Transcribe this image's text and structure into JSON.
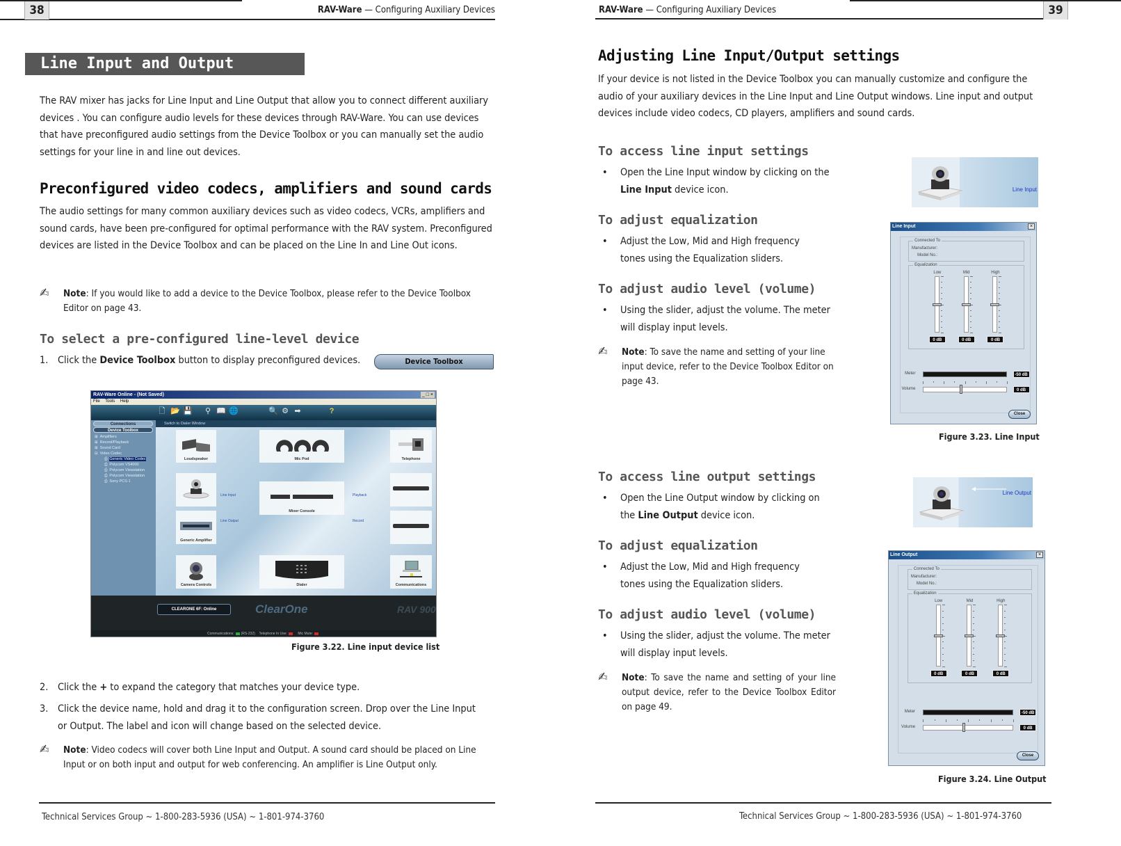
{
  "left_page": {
    "page_number": "38",
    "running_head": {
      "product": "RAV-Ware",
      "separator": "—",
      "section": "Configuring Auxiliary Devices"
    },
    "section_title": "Line Input and Output",
    "intro": "The RAV mixer has jacks for Line Input and Line Output that allow you to connect different auxiliary devices . You can configure audio levels for these devices through RAV-Ware. You can use devices that have preconfigured audio settings from the Device Toolbox or you can manually set the audio settings for your line in and line out devices.",
    "preconfigured": {
      "heading": "Preconfigured video codecs, amplifiers and sound cards",
      "body": "The audio settings for many common auxiliary devices such as video codecs, VCRs, amplifiers and sound cards, have been pre-configured for optimal performance with the RAV system. Preconfigured devices are listed in the Device Toolbox and can be placed on the Line In and Line Out icons."
    },
    "note1": {
      "label": "Note",
      "text": ": If you would like to add a device to the Device Toolbox, please refer to the Device Toolbox Editor on page 43."
    },
    "select_heading": "To select a pre-configured line-level device",
    "steps": [
      {
        "num": "1.",
        "pre": "Click the ",
        "bold": "Device Toolbox",
        "post": " button to display preconfigured devices."
      },
      {
        "num": "2.",
        "pre": "Click the ",
        "bold": "+",
        "post": " to expand the category that matches your device type."
      },
      {
        "num": "3.",
        "pre": "Click the device name, hold and drag it to the configuration screen. Drop over the Line Input or Output. The label and icon will change based on the selected device.",
        "bold": "",
        "post": ""
      }
    ],
    "device_toolbox_button": "Device Toolbox",
    "figure_caption": "Figure 3.22. Line input device list",
    "note2": {
      "label": "Note",
      "text": ": Video codecs will cover both Line Input and Output. A sound card should be placed on Line Input or on both input and output for web conferencing. An amplifier is Line Output only."
    },
    "footer": "Technical Services Group ~ 1-800-283-5936 (USA) ~ 1-801-974-3760"
  },
  "screenshot": {
    "title": "RAV-Ware    Online - (Not Saved)",
    "window_buttons": "_ □ ×",
    "menu": [
      "File",
      "Tools",
      "Help"
    ],
    "sidebar_buttons": {
      "connections": "Connections",
      "device_toolbox": "Device Toolbox"
    },
    "tree": [
      {
        "expander": "⊞",
        "label": "Amplifiers",
        "indent": false,
        "selected": false
      },
      {
        "expander": "⊞",
        "label": "Record/Playback",
        "indent": false,
        "selected": false
      },
      {
        "expander": "⊞",
        "label": "Sound Card",
        "indent": false,
        "selected": false
      },
      {
        "expander": "⊟",
        "label": "Video Codec",
        "indent": false,
        "selected": false
      },
      {
        "expander": "",
        "label": "Generic   Video Codec",
        "indent": true,
        "selected": true
      },
      {
        "expander": "",
        "label": "Polycom   VS4000",
        "indent": true,
        "selected": false
      },
      {
        "expander": "",
        "label": "Polycom   Viewstation",
        "indent": true,
        "selected": false
      },
      {
        "expander": "",
        "label": "Polycom   Viewstation",
        "indent": true,
        "selected": false
      },
      {
        "expander": "",
        "label": "Sony   PCS-1",
        "indent": true,
        "selected": false
      }
    ],
    "switch_link": "Switch to Dialer Window",
    "tiles": {
      "loudspeaker": "Loudspeaker",
      "mic_pod": "Mic Pod",
      "telephone": "Telephone",
      "camera_line_input": "",
      "mixer_console": "Mixer Console",
      "playback_device": "",
      "generic_amplifier": "Generic Amplifier",
      "record_device": "",
      "camera_controls": "Camera Controls",
      "dialer": "Dialer",
      "communications": "Communications"
    },
    "links": {
      "line_input": "Line Input",
      "line_output": "Line Output",
      "playback": "Playback",
      "record": "Record"
    },
    "online_status": "CLEARONE 6F: Online",
    "brand": "ClearOne",
    "model": "RAV 900",
    "status": {
      "communications": "Communications:",
      "rs232": "(RS-232)",
      "telephone": "Telephone In Use:",
      "mic_mute": "Mic Mute:"
    },
    "status_colors": {
      "communications": "#2fa83a",
      "telephone": "#d42a2a",
      "mic_mute": "#d42a2a"
    }
  },
  "right_page": {
    "page_number": "39",
    "running_head": {
      "product": "RAV-Ware",
      "separator": "—",
      "section": "Configuring Auxiliary Devices"
    },
    "title": "Adjusting Line Input/Output settings",
    "intro": "If your device is not listed in the Device Toolbox you can manually customize and configure the audio of your auxiliary devices in the Line Input and Line Output windows. Line input and output devices include video codecs, CD players, amplifiers and sound cards.",
    "input_section": {
      "access_heading": "To access line input settings",
      "access_bullet": {
        "pre": "Open the Line Input window by clicking on the ",
        "bold": "Line Input",
        "post": " device icon."
      },
      "eq_heading": "To adjust equalization",
      "eq_bullet": "Adjust the Low, Mid and High frequency tones using the Equalization sliders.",
      "vol_heading": "To adjust audio level (volume)",
      "vol_bullet": "Using the slider, adjust the volume. The meter will display input levels.",
      "note": {
        "label": "Note",
        "text": ": To save the name and setting of your line input device, refer to the Device Toolbox Editor on page 43."
      }
    },
    "output_section": {
      "access_heading": "To access line output settings",
      "access_bullet": {
        "pre": "Open the Line Output window by clicking on the ",
        "bold": "Line Output",
        "post": " device icon."
      },
      "eq_heading": "To adjust equalization",
      "eq_bullet": "Adjust the Low, Mid and High frequency tones using the Equalization sliders.",
      "vol_heading": "To adjust audio level (volume)",
      "vol_bullet": "Using the slider, adjust the volume. The meter will display input levels.",
      "note": {
        "label": "Note",
        "text": ": To save the name and setting of your line output device, refer to the Device Toolbox Editor on page 49."
      }
    },
    "thumb_input_label": "Line Input",
    "thumb_output_label": "Line Output",
    "dialog_input": {
      "title": "Line Input",
      "close_x": "×",
      "connected_to": "Connected To",
      "manufacturer": "Manufacturer:",
      "model_no": "Model No.:",
      "equalization": "Equalization",
      "bands": [
        {
          "label": "Low",
          "value": "0 dB",
          "level": 0.5
        },
        {
          "label": "Mid",
          "value": "0 dB",
          "level": 0.5
        },
        {
          "label": "High",
          "value": "0 dB",
          "level": 0.5
        }
      ],
      "meter_label": "Meter",
      "meter_value": "-50 dB",
      "volume_label": "Volume",
      "volume_value": "0 dB",
      "volume_level": 0.45,
      "close_button": "Close"
    },
    "dialog_output": {
      "title": "Line Output",
      "close_x": "×",
      "connected_to": "Connected To",
      "manufacturer": "Manufacturer:",
      "model_no": "Model No.:",
      "equalization": "Equalization",
      "bands": [
        {
          "label": "Low",
          "value": "0 dB",
          "level": 0.5
        },
        {
          "label": "Mid",
          "value": "0 dB",
          "level": 0.5
        },
        {
          "label": "High",
          "value": "0 dB",
          "level": 0.5
        }
      ],
      "meter_label": "Meter",
      "meter_value": "-50 dB",
      "volume_label": "Volume",
      "volume_value": "0 dB",
      "volume_level": 0.45,
      "close_button": "Close"
    },
    "figure_input_caption": "Figure 3.23. Line Input",
    "figure_output_caption": "Figure 3.24. Line Output",
    "footer": "Technical Services Group ~ 1-800-283-5936 (USA) ~ 1-801-974-3760"
  }
}
